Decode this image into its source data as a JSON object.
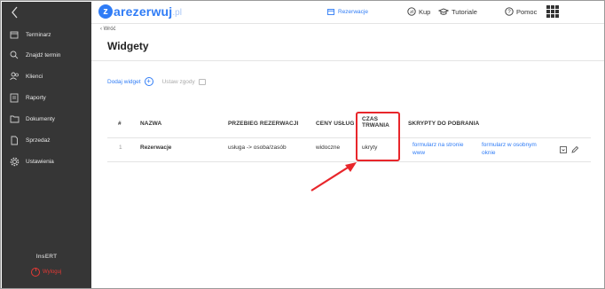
{
  "sidebar": {
    "items": [
      {
        "label": "Terminarz",
        "icon": "calendar-icon"
      },
      {
        "label": "Znajdź termin",
        "icon": "search-icon"
      },
      {
        "label": "Klienci",
        "icon": "users-icon"
      },
      {
        "label": "Raporty",
        "icon": "report-icon"
      },
      {
        "label": "Dokumenty",
        "icon": "folder-icon"
      },
      {
        "label": "Sprzedaż",
        "icon": "document-icon"
      },
      {
        "label": "Ustawienia",
        "icon": "gear-icon"
      }
    ],
    "brand": "InsERT",
    "logout_label": "Wyloguj"
  },
  "topbar": {
    "logo_letter": "z",
    "logo_word": "arezerwuj",
    "logo_tld": ".pl",
    "reservation_label": "Rezerwacje",
    "buy_label": "Kup",
    "tutorials_label": "Tutoriale",
    "help_label": "Pomoc"
  },
  "breadcrumb": "‹ Wróć",
  "page_title": "Widgety",
  "actions": {
    "add_widget": "Dodaj widget",
    "set_consents": "Ustaw zgody"
  },
  "table": {
    "headers": {
      "index": "#",
      "name": "NAZWA",
      "flow": "PRZEBIEG REZERWACJI",
      "prices": "CENY USŁUG",
      "duration_line1": "CZAS",
      "duration_line2": "TRWANIA",
      "scripts": "SKRYPTY DO POBRANIA"
    },
    "rows": [
      {
        "index": "1",
        "name": "Rezerwacje",
        "flow": "usługa -> osoba/zasób",
        "prices": "widoczne",
        "duration": "ukryty",
        "script1_line1": "formularz na stronie",
        "script1_line2": "www",
        "script2_line1": "formularz w osobnym",
        "script2_line2": "oknie"
      }
    ]
  },
  "colors": {
    "accent": "#2f7cf6",
    "sidebar_bg": "#363636",
    "highlight": "#e8262b"
  }
}
